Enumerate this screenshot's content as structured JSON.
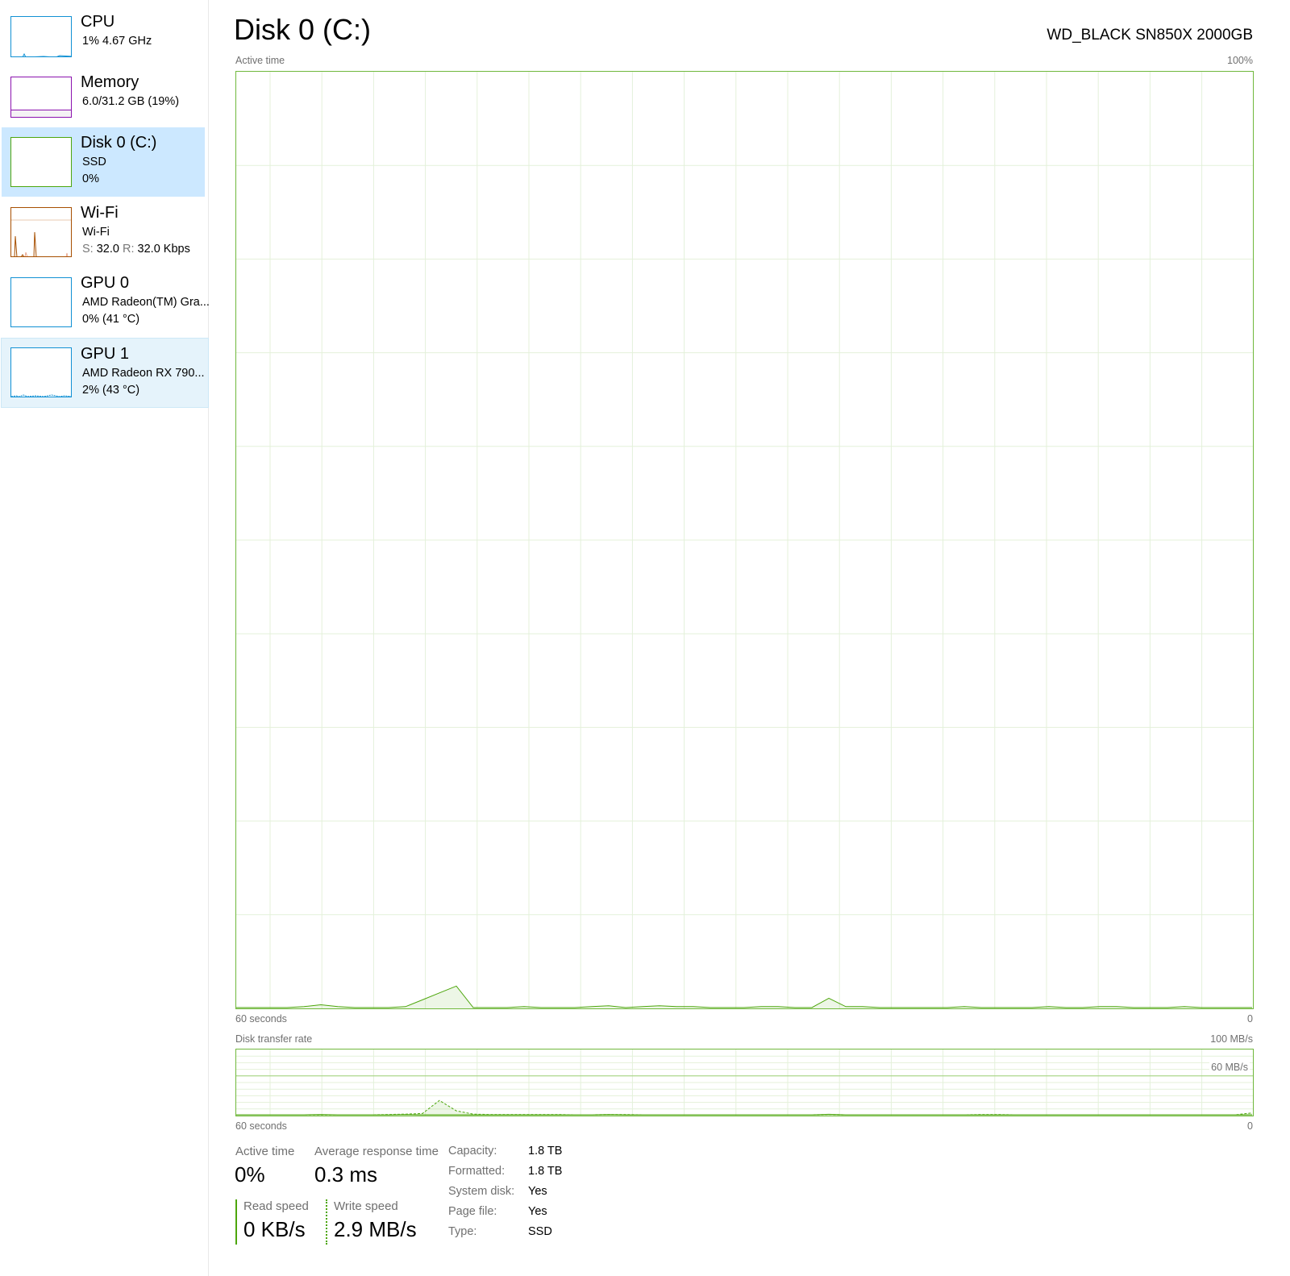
{
  "sidebar": {
    "items": [
      {
        "name": "CPU",
        "line1": "1%  4.67 GHz",
        "color": "#1191d4"
      },
      {
        "name": "Memory",
        "line1": "6.0/31.2 GB (19%)",
        "color": "#8b12ae"
      },
      {
        "name": "Disk 0 (C:)",
        "line1": "SSD",
        "line2": "0%",
        "color": "#4da60c"
      },
      {
        "name": "Wi-Fi",
        "line1": "Wi-Fi",
        "send_label": "S:",
        "send": "32.0",
        "recv_label": "R:",
        "recv": "32.0 Kbps",
        "color": "#a74f01"
      },
      {
        "name": "GPU 0",
        "line1": "AMD Radeon(TM) Gra...",
        "line2": "0%  (41 °C)",
        "color": "#1191d4"
      },
      {
        "name": "GPU 1",
        "line1": "AMD Radeon RX 790...",
        "line2": "2%  (43 °C)",
        "color": "#1191d4"
      }
    ]
  },
  "header": {
    "title": "Disk 0 (C:)",
    "model": "WD_BLACK SN850X 2000GB"
  },
  "chart_data": [
    {
      "type": "area",
      "title": "Active time",
      "ylabel_max": "100%",
      "xlabel_left": "60 seconds",
      "xlabel_right": "0",
      "ylim": [
        0,
        100
      ],
      "x_range_seconds": 60,
      "series": [
        {
          "name": "Active time",
          "values": [
            0,
            0,
            0,
            0,
            0.1,
            0.3,
            0.1,
            0,
            0,
            0,
            0.1,
            0.83,
            1.57,
            2.3,
            0,
            0,
            0,
            0.1,
            0,
            0,
            0,
            0.1,
            0.2,
            0,
            0.1,
            0.2,
            0.1,
            0.1,
            0,
            0,
            0,
            0.1,
            0.1,
            0,
            0,
            1.0,
            0.1,
            0.1,
            0,
            0,
            0,
            0,
            0,
            0.1,
            0,
            0,
            0,
            0,
            0.1,
            0,
            0,
            0.1,
            0.1,
            0,
            0,
            0,
            0.1,
            0,
            0,
            0,
            0
          ]
        }
      ]
    },
    {
      "type": "line",
      "title": "Disk transfer rate",
      "ylabel_max": "100 MB/s",
      "ref_line_label": "60 MB/s",
      "ref_line_value": 60,
      "xlabel_left": "60 seconds",
      "xlabel_right": "0",
      "ylim": [
        0,
        100
      ],
      "x_range_seconds": 60,
      "series": [
        {
          "name": "Read speed",
          "style": "solid",
          "values": [
            0,
            0,
            0,
            0,
            0,
            0.5,
            0,
            0,
            0,
            0,
            0.5,
            0,
            0,
            0,
            0,
            0,
            0,
            0,
            0,
            0,
            0,
            0,
            0.5,
            0,
            0,
            0,
            0,
            0,
            0,
            0,
            0,
            0,
            0,
            0,
            0,
            0.8,
            0,
            0,
            0,
            0,
            0,
            0,
            0,
            0,
            0,
            0,
            0,
            0,
            0,
            0,
            0,
            0,
            0,
            0,
            0,
            0,
            0,
            0,
            0,
            0,
            0
          ]
        },
        {
          "name": "Write speed",
          "style": "dashed",
          "values": [
            0,
            0,
            0,
            0,
            0,
            0,
            0,
            0,
            0,
            0.5,
            1,
            2,
            22,
            6,
            1,
            0.5,
            0.5,
            0.5,
            0.5,
            0.5,
            0,
            0,
            0.5,
            0.5,
            0,
            0,
            0,
            0,
            0,
            0,
            0,
            0,
            0,
            0,
            0,
            0.5,
            0,
            0,
            0,
            0,
            0,
            0,
            0,
            0,
            0.5,
            0.5,
            0,
            0,
            0,
            0,
            0,
            0,
            0,
            0,
            0,
            0,
            0,
            0,
            0,
            0,
            2.9
          ]
        }
      ]
    }
  ],
  "stats": {
    "active_time_label": "Active time",
    "active_time": "0%",
    "avg_response_label": "Average response time",
    "avg_response": "0.3 ms",
    "read_label": "Read speed",
    "read": "0 KB/s",
    "write_label": "Write speed",
    "write": "2.9 MB/s"
  },
  "properties": [
    {
      "label": "Capacity:",
      "value": "1.8 TB"
    },
    {
      "label": "Formatted:",
      "value": "1.8 TB"
    },
    {
      "label": "System disk:",
      "value": "Yes"
    },
    {
      "label": "Page file:",
      "value": "Yes"
    },
    {
      "label": "Type:",
      "value": "SSD"
    }
  ]
}
